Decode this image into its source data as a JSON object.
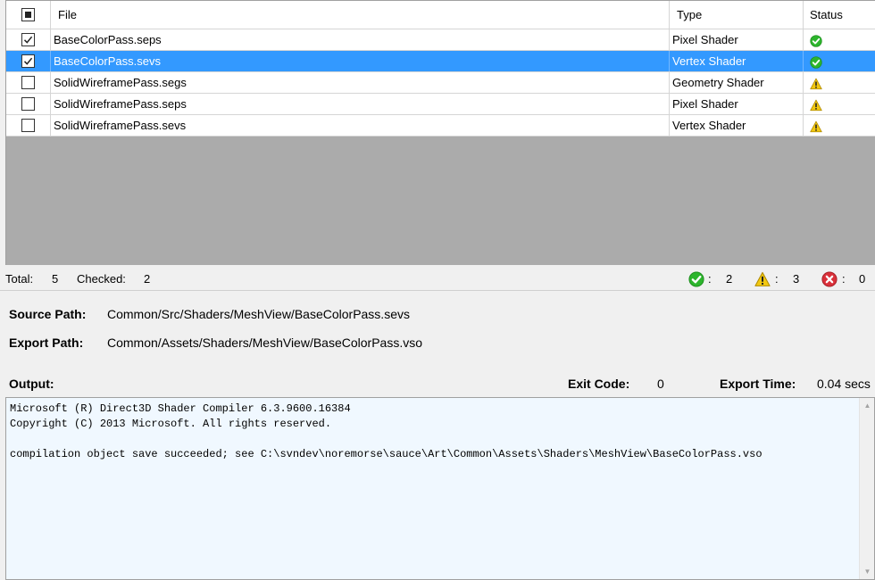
{
  "grid": {
    "headers": {
      "file": "File",
      "type": "Type",
      "status": "Status"
    },
    "rows": [
      {
        "file": "BaseColorPass.seps",
        "type": "Pixel Shader",
        "checked": true,
        "status": "ok",
        "selected": false
      },
      {
        "file": "BaseColorPass.sevs",
        "type": "Vertex Shader",
        "checked": true,
        "status": "ok",
        "selected": true
      },
      {
        "file": "SolidWireframePass.segs",
        "type": "Geometry Shader",
        "checked": false,
        "status": "warning",
        "selected": false
      },
      {
        "file": "SolidWireframePass.seps",
        "type": "Pixel Shader",
        "checked": false,
        "status": "warning",
        "selected": false
      },
      {
        "file": "SolidWireframePass.sevs",
        "type": "Vertex Shader",
        "checked": false,
        "status": "warning",
        "selected": false
      }
    ]
  },
  "totals": {
    "total_label": "Total:",
    "total_value": "5",
    "checked_label": "Checked:",
    "checked_value": "2",
    "ok_count": "2",
    "warning_count": "3",
    "error_count": "0",
    "separator": ":"
  },
  "details": {
    "source_label": "Source Path:",
    "source_value": "Common/Src/Shaders/MeshView/BaseColorPass.sevs",
    "export_label": "Export Path:",
    "export_value": "Common/Assets/Shaders/MeshView/BaseColorPass.vso",
    "output_label": "Output:",
    "exit_code_label": "Exit Code:",
    "exit_code_value": "0",
    "export_time_label": "Export Time:",
    "export_time_value": "0.04 secs"
  },
  "output": {
    "text": "Microsoft (R) Direct3D Shader Compiler 6.3.9600.16384\nCopyright (C) 2013 Microsoft. All rights reserved.\n\ncompilation object save succeeded; see C:\\svndev\\noremorse\\sauce\\Art\\Common\\Assets\\Shaders\\MeshView\\BaseColorPass.vso"
  },
  "colors": {
    "selection": "#3399ff",
    "ok": "#2db52d",
    "warning": "#f2c811",
    "error": "#d9303a",
    "output_bg": "#f0f8ff"
  }
}
